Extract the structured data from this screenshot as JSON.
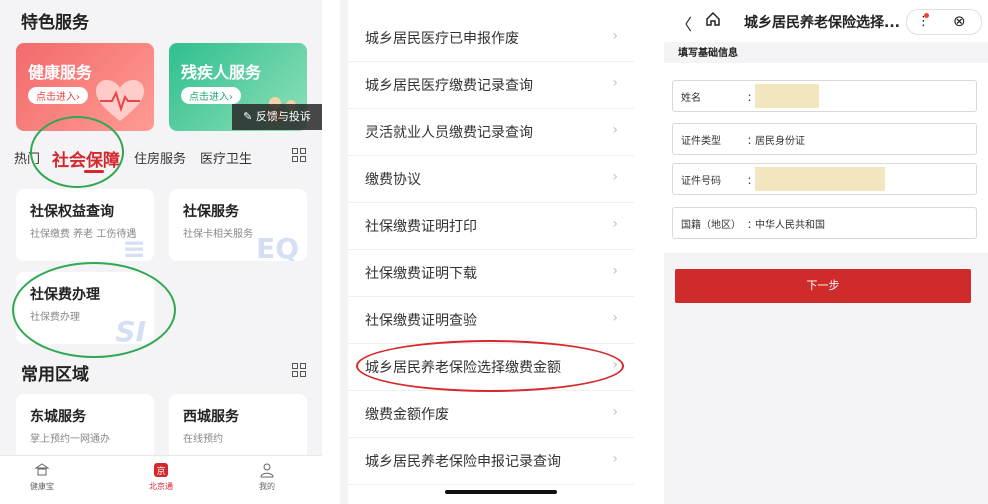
{
  "panel1": {
    "section_title": "特色服务",
    "cards": [
      {
        "title": "健康服务",
        "button": "点击进入›"
      },
      {
        "title": "残疾人服务",
        "button": "点击进入›"
      }
    ],
    "feedback": "反馈与投诉",
    "tabs": [
      "热门",
      "社会保障",
      "住房服务",
      "医疗卫生"
    ],
    "active_tab": "社会保障",
    "services": [
      {
        "title": "社保权益查询",
        "subtitle": "社保缴费 养老 工伤待遇",
        "deco": "≡"
      },
      {
        "title": "社保服务",
        "subtitle": "社保卡相关服务",
        "deco": "EQ"
      },
      {
        "title": "社保费办理",
        "subtitle": "社保费办理",
        "deco": "SI"
      }
    ],
    "common_section_title": "常用区域",
    "regions": [
      {
        "title": "东城服务",
        "subtitle": "掌上预约一网通办"
      },
      {
        "title": "西城服务",
        "subtitle": "在线预约"
      }
    ],
    "bottom_nav": [
      {
        "label": "健康宝",
        "icon": "temple-icon"
      },
      {
        "label": "北京通",
        "icon": "beijing-logo-icon"
      },
      {
        "label": "我的",
        "icon": "person-icon"
      }
    ]
  },
  "panel2": {
    "items": [
      "城乡居民医疗已申报作废",
      "城乡居民医疗缴费记录查询",
      "灵活就业人员缴费记录查询",
      "缴费协议",
      "社保缴费证明打印",
      "社保缴费证明下载",
      "社保缴费证明查验",
      "城乡居民养老保险选择缴费金额",
      "缴费金额作废",
      "城乡居民养老保险申报记录查询"
    ],
    "arrow": "›"
  },
  "panel3": {
    "title": "城乡居民养老保险选择...",
    "section_label": "填写基础信息",
    "fields": [
      {
        "label": "姓名",
        "value": ""
      },
      {
        "label": "证件类型",
        "value": "居民身份证"
      },
      {
        "label": "证件号码",
        "value": ""
      },
      {
        "label": "国籍（地区）",
        "value": "中华人民共和国"
      }
    ],
    "next_button": "下一步",
    "colon": "："
  },
  "colors": {
    "brand_red": "#d4282e",
    "highlight_green": "#2fa84f",
    "highlight_red": "#d62a2a"
  }
}
